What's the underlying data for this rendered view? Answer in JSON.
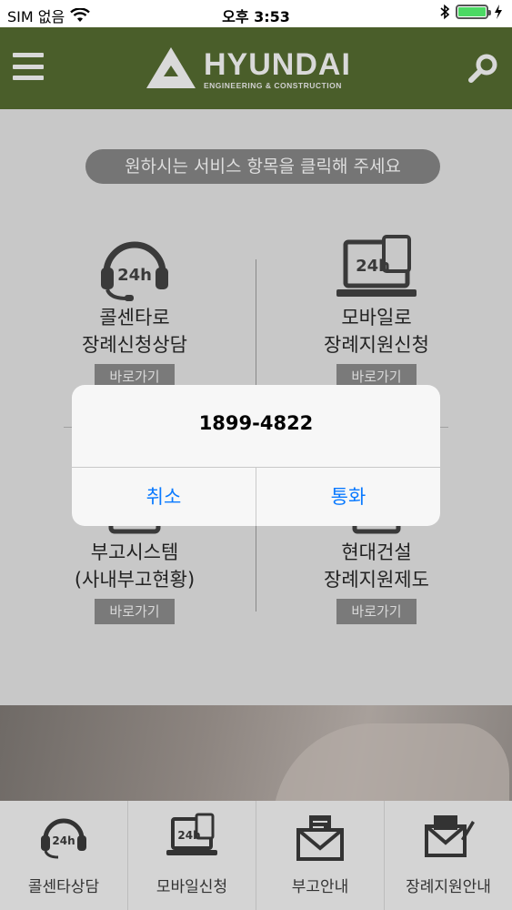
{
  "status_bar": {
    "carrier": "SIM 없음",
    "time": "오후 3:53"
  },
  "header": {
    "logo_text": "HYUNDAI",
    "logo_subtext": "ENGINEERING & CONSTRUCTION"
  },
  "main": {
    "guide_text": "원하시는 서비스 항목을 클릭해 주세요",
    "services": [
      {
        "icon": "headset-24h-icon",
        "line1": "콜센타로",
        "line2": "장례신청상담",
        "button": "바로가기"
      },
      {
        "icon": "laptop-24h-icon",
        "line1": "모바일로",
        "line2": "장례지원신청",
        "button": "바로가기"
      },
      {
        "icon": "document-icon",
        "line1": "부고시스템",
        "line2": "(사내부고현황)",
        "button": "바로가기"
      },
      {
        "icon": "building-icon",
        "line1": "현대건설",
        "line2": "장례지원제도",
        "button": "바로가기"
      }
    ]
  },
  "tab_bar": {
    "tabs": [
      {
        "icon": "headset-24h-icon",
        "label": "콜센타상담"
      },
      {
        "icon": "laptop-24h-icon",
        "label": "모바일신청"
      },
      {
        "icon": "envelope-icon",
        "label": "부고안내"
      },
      {
        "icon": "letter-pen-icon",
        "label": "장례지원안내"
      }
    ]
  },
  "alert": {
    "message": "1899-4822",
    "cancel_label": "취소",
    "call_label": "통화"
  },
  "colors": {
    "header_bg": "#4a5e2a",
    "alert_button": "#0a7aff",
    "battery": "#4cd964"
  }
}
